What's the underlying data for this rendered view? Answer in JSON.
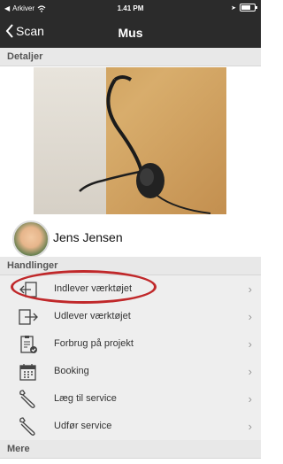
{
  "status_bar": {
    "back_app": "Arkiver",
    "time": "1.41 PM"
  },
  "nav": {
    "back_label": "Scan",
    "title": "Mus"
  },
  "sections": {
    "details": "Detaljer",
    "actions": "Handlinger",
    "more": "Mere"
  },
  "profile": {
    "name": "Jens Jensen"
  },
  "actions": [
    {
      "label": "Indlever værktøjet",
      "icon": "tool-return-icon"
    },
    {
      "label": "Udlever værktøjet",
      "icon": "tool-checkout-icon"
    },
    {
      "label": "Forbrug på projekt",
      "icon": "clipboard-icon"
    },
    {
      "label": "Booking",
      "icon": "calendar-icon"
    },
    {
      "label": "Læg til service",
      "icon": "wrench-icon"
    },
    {
      "label": "Udfør service",
      "icon": "wrench-icon"
    }
  ],
  "colors": {
    "nav_bg": "#2b2b2b",
    "highlight": "#c0282a",
    "row_bg": "#eeeeee"
  }
}
